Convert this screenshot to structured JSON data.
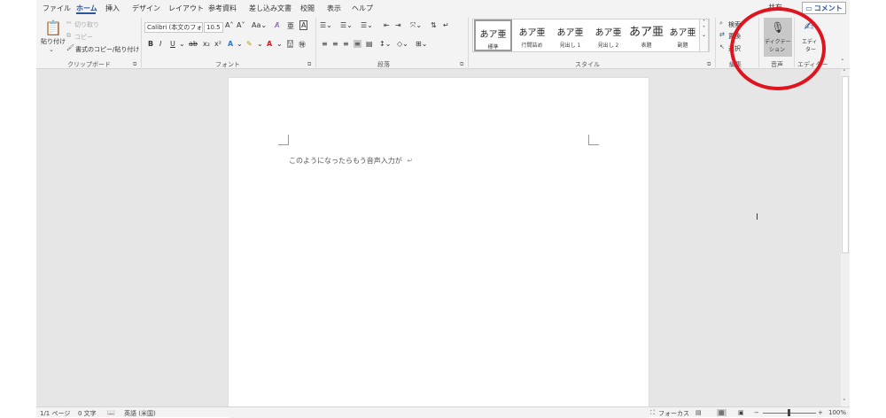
{
  "tabs": [
    {
      "label": "ファイル"
    },
    {
      "label": "ホーム"
    },
    {
      "label": "挿入"
    },
    {
      "label": "デザイン"
    },
    {
      "label": "レイアウト"
    },
    {
      "label": "参考資料"
    },
    {
      "label": "差し込み文書"
    },
    {
      "label": "校閲"
    },
    {
      "label": "表示"
    },
    {
      "label": "ヘルプ"
    }
  ],
  "header": {
    "share_label": "共有",
    "comment_label": "コメント"
  },
  "clipboard": {
    "paste_label": "貼り付け",
    "cut_label": "切り取り",
    "copy_label": "コピー",
    "format_painter_label": "書式のコピー/貼り付け",
    "group_label": "クリップボード"
  },
  "font": {
    "font_name": "Calibri (本文のフォ",
    "font_size": "10.5",
    "group_label": "フォント",
    "highlight_color": "#ffff00",
    "font_color": "#e0141e"
  },
  "paragraph": {
    "group_label": "段落"
  },
  "styles": {
    "items": [
      {
        "preview": "あア亜",
        "name": "標準"
      },
      {
        "preview": "あア亜",
        "name": "行間詰め"
      },
      {
        "preview": "あア亜",
        "name": "見出し 1"
      },
      {
        "preview": "あア亜",
        "name": "見出し 2"
      },
      {
        "preview": "あア亜",
        "name": "表題"
      },
      {
        "preview": "あア亜",
        "name": "副題"
      }
    ],
    "group_label": "スタイル"
  },
  "editing": {
    "find_label": "検索",
    "replace_label": "置換",
    "select_label": "選択",
    "group_label": "編集"
  },
  "voice": {
    "dictate_label_1": "ディクテー",
    "dictate_label_2": "ション",
    "group_label": "音声"
  },
  "editor": {
    "label_1": "エディ",
    "label_2": "ター",
    "group_label": "エディター"
  },
  "document": {
    "text": "このようになったらもう音声入力が",
    "paragraph_mark": "↵"
  },
  "status": {
    "page": "1/1 ページ",
    "words": "0 文字",
    "language": "英語 (米国)",
    "focus": "フォーカス",
    "zoom": "100%"
  },
  "colors": {
    "accent": "#2b579a",
    "annotation": "#e0141e"
  }
}
